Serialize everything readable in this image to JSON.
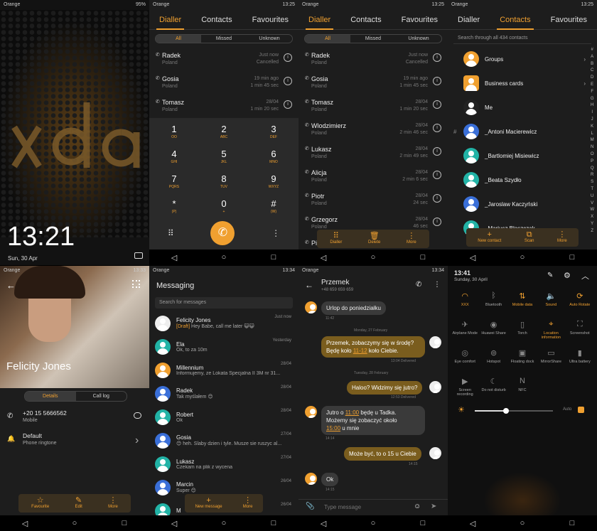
{
  "status": {
    "carrier": "Orange",
    "battery_lock": "95%",
    "battery": "94%",
    "t1": "13:25",
    "t2": "13:33",
    "t3": "13:34"
  },
  "lock": {
    "time": "13:21",
    "date": "Sun, 30 Apr"
  },
  "tabs": {
    "dialler": "Dialler",
    "contacts": "Contacts",
    "favourites": "Favourites"
  },
  "filters": {
    "all": "All",
    "missed": "Missed",
    "unknown": "Unknown"
  },
  "calls": [
    {
      "name": "Radek",
      "loc": "Poland",
      "when": "Just now",
      "dur": "Cancelled"
    },
    {
      "name": "Gosia",
      "loc": "Poland",
      "when": "19 min ago",
      "dur": "1 min 45 sec"
    },
    {
      "name": "Tomasz",
      "loc": "Poland",
      "when": "28/04",
      "dur": "1 min 20 sec"
    },
    {
      "name": "Wlodzimierz",
      "loc": "Poland",
      "when": "28/04",
      "dur": "2 min 46 sec"
    },
    {
      "name": "Lukasz",
      "loc": "Poland",
      "when": "28/04",
      "dur": "2 min 49 sec"
    },
    {
      "name": "Alicja",
      "loc": "Poland",
      "when": "28/04",
      "dur": "2 min 6 sec"
    },
    {
      "name": "Piotr",
      "loc": "Poland",
      "when": "28/04",
      "dur": "24 sec"
    },
    {
      "name": "Grzegorz",
      "loc": "Poland",
      "when": "28/04",
      "dur": "46 sec"
    },
    {
      "name": "Pi",
      "loc": "",
      "when": "",
      "dur": ""
    }
  ],
  "keys": [
    {
      "d": "1",
      "l": "OO"
    },
    {
      "d": "2",
      "l": "ABC"
    },
    {
      "d": "3",
      "l": "DEF"
    },
    {
      "d": "4",
      "l": "GHI"
    },
    {
      "d": "5",
      "l": "JKL"
    },
    {
      "d": "6",
      "l": "MNO"
    },
    {
      "d": "7",
      "l": "PQRS"
    },
    {
      "d": "8",
      "l": "TUV"
    },
    {
      "d": "9",
      "l": "WXYZ"
    },
    {
      "d": "*",
      "l": "(P)"
    },
    {
      "d": "0",
      "l": "+"
    },
    {
      "d": "#",
      "l": "(W)"
    }
  ],
  "callsbar": {
    "dialler": "Dialler",
    "delete": "Delete",
    "more": "More"
  },
  "contacts": {
    "search": "Search through all 434 contacts",
    "groups": "Groups",
    "business": "Business cards",
    "me": "Me",
    "hash": "#",
    "list": [
      "_Antoni Macierewicz",
      "_Bartlomiej Misiewicz",
      "_Beata Szydło",
      "_Jaroslaw Kaczyński",
      "_Mariusz Błaszczak"
    ],
    "alpha": "ABCDEFGHIJKLMNOPQRSTUVWXYZ",
    "bar": {
      "new": "New contact",
      "scan": "Scan",
      "more": "More"
    }
  },
  "detail": {
    "name": "Felicity Jones",
    "tab1": "Details",
    "tab2": "Call log",
    "number": "+20 15 5666562",
    "ntype": "Mobile",
    "ringtone": "Default",
    "rlabel": "Phone ringtone",
    "bar": {
      "fav": "Favourite",
      "edit": "Edit",
      "more": "More"
    }
  },
  "messaging": {
    "title": "Messaging",
    "search": "Search for messages",
    "threads": [
      {
        "name": "Felicity Jones",
        "draft": "[Draft]",
        "msg": "Hey Babe, call me later 😺😺",
        "date": "Just now"
      },
      {
        "name": "Ela",
        "msg": "Ok, to za 10m",
        "date": "Yesterday"
      },
      {
        "name": "Millennium",
        "msg": "Informujemy, ze Lokata Specjalna II 3M nr 31...",
        "date": "28/04"
      },
      {
        "name": "Radek",
        "msg": "Tak myślałem 😊",
        "date": "28/04"
      },
      {
        "name": "Robert",
        "msg": "Ok",
        "date": "28/04"
      },
      {
        "name": "Gosia",
        "msg": "😊 heh. Slaby dzien i tyle. Musze sie ruszyc al...",
        "date": "27/04"
      },
      {
        "name": "Lukasz",
        "msg": "Czekam na plik z wycena",
        "date": "27/04"
      },
      {
        "name": "Marcin",
        "msg": "Super 😊",
        "date": "26/04"
      },
      {
        "name": "M",
        "msg": "",
        "date": "26/04"
      }
    ],
    "bar": {
      "new": "New message",
      "more": "More"
    }
  },
  "chat": {
    "name": "Przemek",
    "num": "+48 659 659 659",
    "m1": "Urlop do poniedziałku",
    "m1t": "11:42",
    "d1": "Monday, 27 February",
    "m2a": "Przemek, zobaczymy się w środę?",
    "m2b": "Będę koło ",
    "m2link": "11-12",
    "m2c": " koło Ciebie.",
    "m2t": "13:04 Delivered",
    "d2": "Tuesday, 28 February",
    "m3": "Haloo? Widzimy się jutro?",
    "m3t": "12:53 Delivered",
    "m4a": "Jutro o ",
    "m4link": "11:00",
    "m4b": " będę u Tadka.",
    "m4c": "Możemy się zobaczyć około",
    "m4link2": "15:00",
    "m4d": " u mnie",
    "m4t": "14:14",
    "m5": "Może być, to o 15 u Ciebie",
    "m5t": "14:15",
    "m6": "Ok",
    "m6t": "14:15",
    "placeholder": "Type message"
  },
  "qs": {
    "time": "13:41",
    "date": "Sunday, 30 April",
    "auto": "Auto",
    "tiles": [
      {
        "label": "XXX",
        "icon": "wifi-icon",
        "on": true
      },
      {
        "label": "Bluetooth",
        "icon": "bluetooth-icon",
        "on": false
      },
      {
        "label": "Mobile data",
        "icon": "mobile-data-icon",
        "on": true
      },
      {
        "label": "Sound",
        "icon": "sound-icon",
        "on": true
      },
      {
        "label": "Auto Rotate",
        "icon": "rotate-icon",
        "on": true
      },
      {
        "label": "Airplane Mode",
        "icon": "airplane-icon",
        "on": false
      },
      {
        "label": "Huawei Share",
        "icon": "share-icon",
        "on": false
      },
      {
        "label": "Torch",
        "icon": "torch-icon",
        "on": false
      },
      {
        "label": "Location information",
        "icon": "location-icon",
        "on": true
      },
      {
        "label": "Screenshot",
        "icon": "screenshot-icon",
        "on": false
      },
      {
        "label": "Eye comfort",
        "icon": "eye-icon",
        "on": false
      },
      {
        "label": "Hotspot",
        "icon": "hotspot-icon",
        "on": false
      },
      {
        "label": "Floating dock",
        "icon": "dock-icon",
        "on": false
      },
      {
        "label": "MirrorShare",
        "icon": "mirror-icon",
        "on": false
      },
      {
        "label": "Ultra battery",
        "icon": "battery-icon",
        "on": false
      },
      {
        "label": "Screen recording",
        "icon": "record-icon",
        "on": false
      },
      {
        "label": "Do not disturb",
        "icon": "moon-icon",
        "on": false
      },
      {
        "label": "NFC",
        "icon": "nfc-icon",
        "on": false
      }
    ],
    "brightness": 0.4
  }
}
